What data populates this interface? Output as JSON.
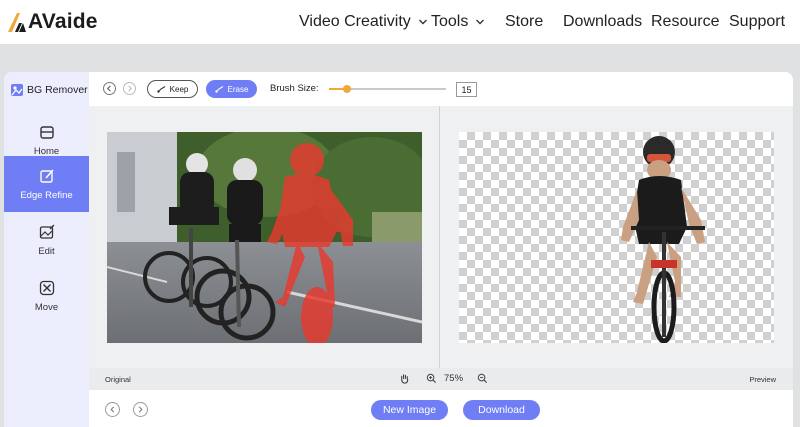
{
  "brand": {
    "name": "AVaide"
  },
  "nav": {
    "items": [
      {
        "label": "Video Creativity",
        "has_dropdown": true
      },
      {
        "label": "Tools",
        "has_dropdown": true
      },
      {
        "label": "Store",
        "has_dropdown": false
      },
      {
        "label": "Downloads",
        "has_dropdown": false
      },
      {
        "label": "Resource",
        "has_dropdown": false
      },
      {
        "label": "Support",
        "has_dropdown": false
      }
    ]
  },
  "sidebar": {
    "title": "BG Remover",
    "items": [
      {
        "label": "Home",
        "icon": "home-icon",
        "active": false
      },
      {
        "label": "Edge Refine",
        "icon": "edge-refine-icon",
        "active": true
      },
      {
        "label": "Edit",
        "icon": "image-edit-icon",
        "active": false
      },
      {
        "label": "Move",
        "icon": "move-icon",
        "active": false
      }
    ]
  },
  "toolbar": {
    "keep_label": "Keep",
    "erase_label": "Erase",
    "brush_size_label": "Brush Size:",
    "brush_size_value": "15",
    "brush_size_fraction": 0.15
  },
  "status": {
    "original_label": "Original",
    "preview_label": "Preview",
    "zoom_level": "75%"
  },
  "actions": {
    "new_image_label": "New Image",
    "download_label": "Download"
  },
  "colors": {
    "accent": "#6f7ef5",
    "sidebar_bg": "#eceefe",
    "slider": "#f2a73a",
    "erase_overlay": "#e8392e"
  }
}
